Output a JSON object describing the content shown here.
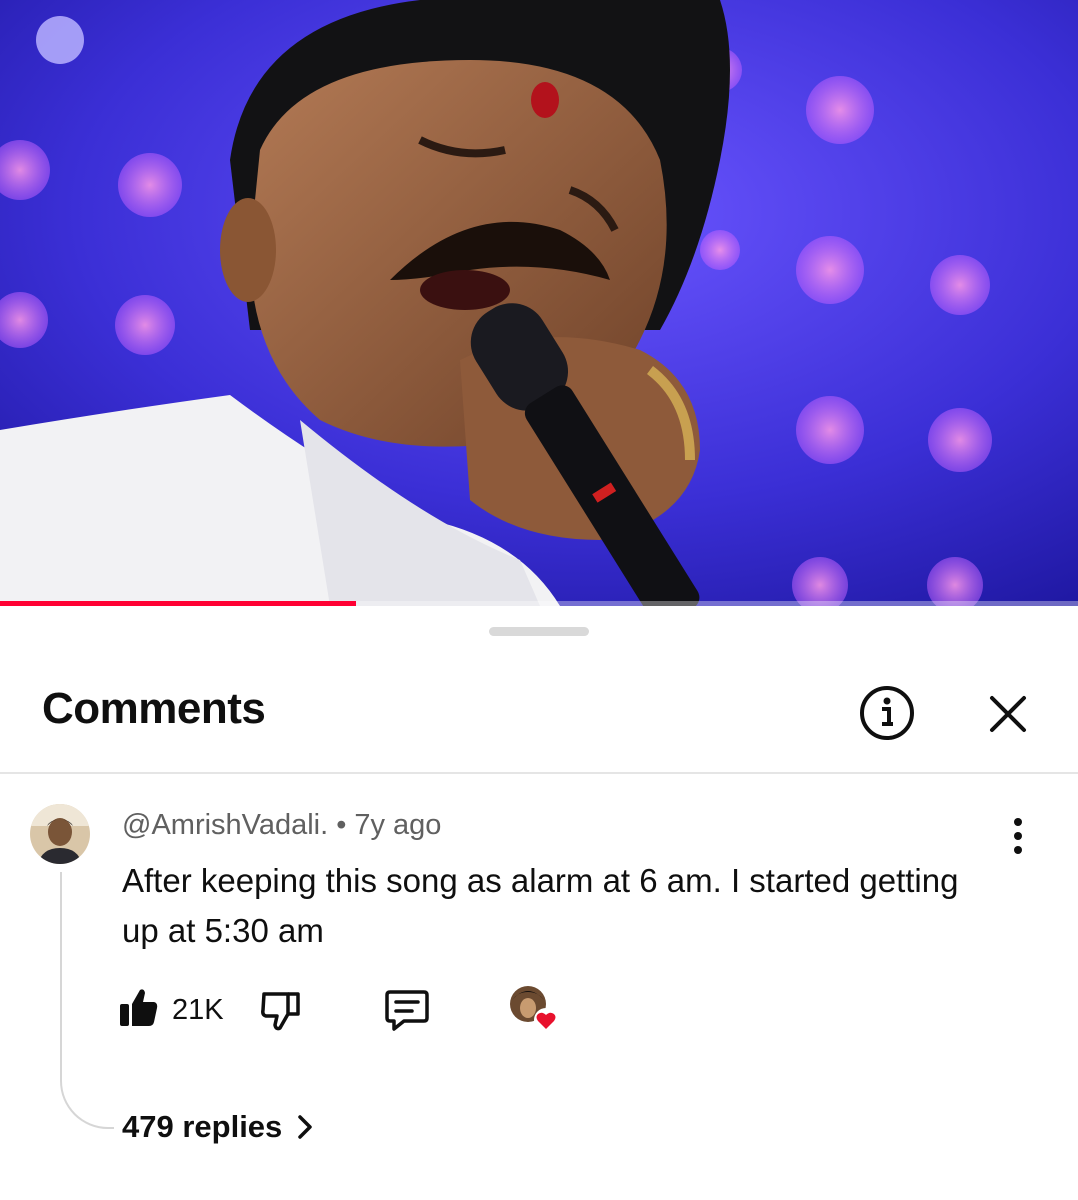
{
  "video": {
    "description_icon": "video-frame",
    "progress_fraction": 0.33
  },
  "comments_panel": {
    "title": "Comments",
    "info_icon": "info-icon",
    "close_icon": "close-icon"
  },
  "comment": {
    "author": "@AmrishVadali.",
    "separator": "•",
    "time": "7y ago",
    "text": "After keeping this song as alarm at 6 am. I started getting up at 5:30 am",
    "like_count": "21K",
    "replies_label": "479 replies"
  },
  "colors": {
    "accent_red": "#ff0033",
    "text_primary": "#0f0f0f",
    "text_secondary": "#606060",
    "heart": "#e8112d"
  }
}
